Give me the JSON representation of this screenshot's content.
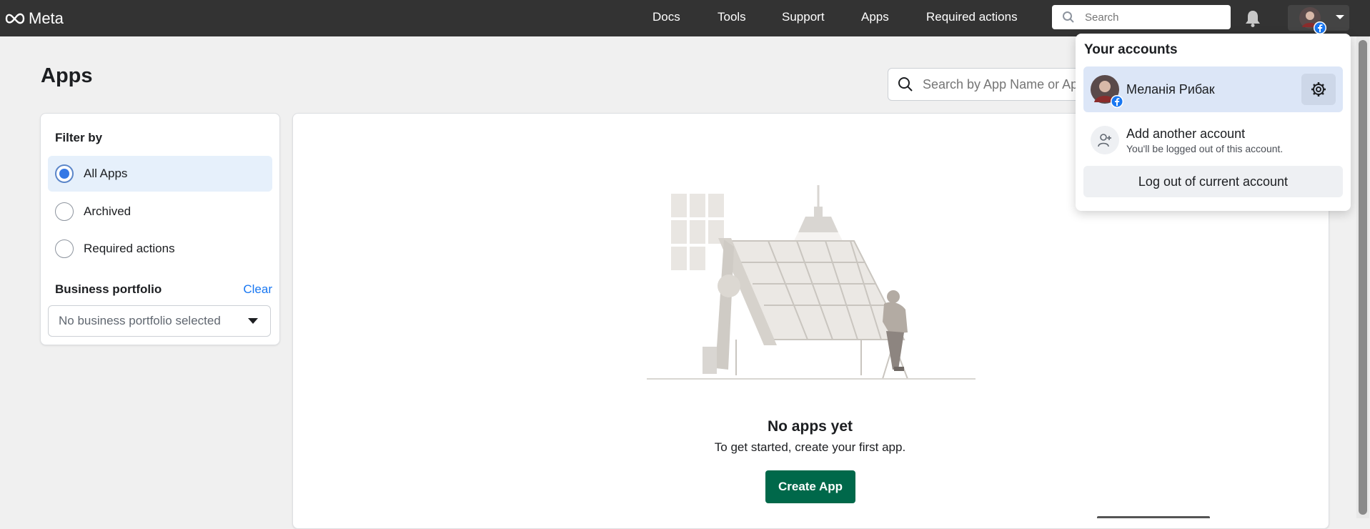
{
  "topbar": {
    "logo_text": "Meta",
    "nav": [
      "Docs",
      "Tools",
      "Support",
      "Apps",
      "Required actions"
    ],
    "search_placeholder": "Search"
  },
  "page": {
    "title": "Apps",
    "search_placeholder": "Search by App Name or App ID"
  },
  "filter": {
    "title": "Filter by",
    "options": [
      {
        "label": "All Apps",
        "selected": true
      },
      {
        "label": "Archived",
        "selected": false
      },
      {
        "label": "Required actions",
        "selected": false
      }
    ],
    "business_portfolio_title": "Business portfolio",
    "clear_label": "Clear",
    "select_value": "No business portfolio selected"
  },
  "empty_state": {
    "title": "No apps yet",
    "subtitle": "To get started, create your first app.",
    "button_label": "Create App"
  },
  "accounts_menu": {
    "title": "Your accounts",
    "current_account_name": "Меланія Рибак",
    "add_title": "Add another account",
    "add_subtitle": "You'll be logged out of this account.",
    "logout_label": "Log out of current account"
  },
  "colors": {
    "topbar": "#333333",
    "accent": "#1877f2",
    "create_button": "#00684a",
    "selected_row": "#e6f0fb"
  }
}
